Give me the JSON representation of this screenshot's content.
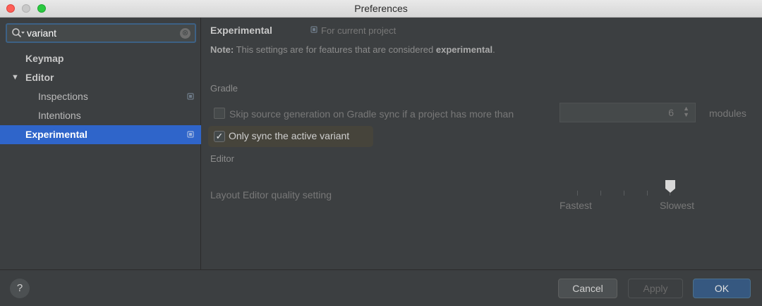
{
  "window": {
    "title": "Preferences"
  },
  "search": {
    "value": "variant",
    "clear_symbol": "⊗"
  },
  "sidebar": {
    "items": [
      {
        "label": "Keymap"
      },
      {
        "label": "Editor",
        "arrow": "▼"
      },
      {
        "label": "Inspections"
      },
      {
        "label": "Intentions"
      },
      {
        "label": "Experimental"
      }
    ]
  },
  "header": {
    "title": "Experimental",
    "project_label": "For current project"
  },
  "note": {
    "prefix": "Note:",
    "text": " This settings are for features that are considered ",
    "bold": "experimental",
    "suffix": "."
  },
  "gradle": {
    "section": "Gradle",
    "skip_label": "Skip source generation on Gradle sync if a project has more than",
    "module_count": "6",
    "modules_label": "modules",
    "sync_active_label": "Only sync the active variant",
    "sync_active_checked": true
  },
  "editor": {
    "section": "Editor",
    "quality_label": "Layout Editor quality setting",
    "fastest_label": "Fastest",
    "slowest_label": "Slowest"
  },
  "footer": {
    "help": "?",
    "cancel": "Cancel",
    "apply": "Apply",
    "ok": "OK"
  },
  "colors": {
    "selection": "#2f65ca",
    "ok_button": "#365880",
    "background": "#3c3f41"
  }
}
